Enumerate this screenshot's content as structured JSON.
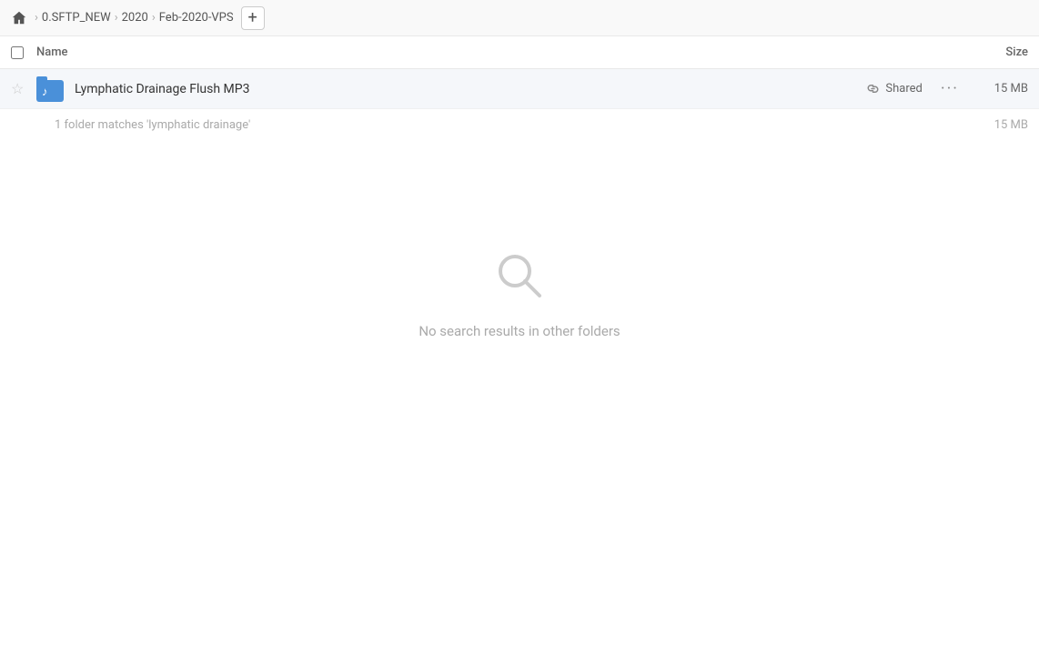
{
  "breadcrumb": {
    "home_icon": "home",
    "items": [
      {
        "label": "0.SFTP_NEW",
        "key": "sftp-new"
      },
      {
        "label": "2020",
        "key": "2020"
      },
      {
        "label": "Feb-2020-VPS",
        "key": "feb-2020-vps"
      }
    ],
    "add_button_label": "+"
  },
  "column_header": {
    "name_label": "Name",
    "size_label": "Size"
  },
  "file_row": {
    "name": "Lymphatic Drainage Flush MP3",
    "shared_label": "Shared",
    "size": "15 MB",
    "star_icon": "☆"
  },
  "matches": {
    "text": "1 folder matches 'lymphatic drainage'",
    "size": "15 MB"
  },
  "empty_state": {
    "icon": "search",
    "message": "No search results in other folders"
  }
}
